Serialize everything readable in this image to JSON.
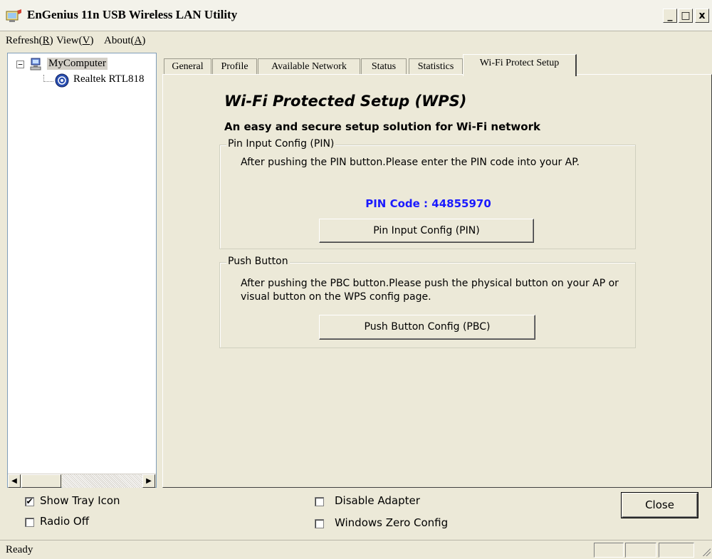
{
  "window": {
    "title": "EnGenius 11n USB Wireless LAN Utility",
    "controls": [
      "minimize-icon",
      "maximize-icon",
      "close-icon"
    ]
  },
  "menu": {
    "items": [
      {
        "label": "Refresh(",
        "key": "R",
        "suffix": ")"
      },
      {
        "label": "View(",
        "key": "V",
        "suffix": ")"
      },
      {
        "label": "About(",
        "key": "A",
        "suffix": ")"
      }
    ]
  },
  "tree": {
    "expander": "−",
    "root": "MyComputer",
    "child": "Realtek RTL818"
  },
  "tabs": [
    {
      "label": "General"
    },
    {
      "label": "Profile"
    },
    {
      "label": "Available Network"
    },
    {
      "label": "Status"
    },
    {
      "label": "Statistics"
    },
    {
      "label": "Wi-Fi Protect Setup",
      "active": true
    }
  ],
  "wps": {
    "title": "Wi-Fi Protected Setup (WPS)",
    "subtitle": "An easy and secure setup solution for Wi-Fi network",
    "pin": {
      "legend": "Pin Input Config (PIN)",
      "description": "After pushing the PIN button.Please enter the PIN code into your AP.",
      "code_label": "PIN Code :",
      "code_value": "44855970",
      "button": "Pin Input Config (PIN)"
    },
    "pbc": {
      "legend": "Push Button",
      "description": "After pushing the PBC button.Please push the physical button on your AP or visual button on the WPS config page.",
      "button": "Push Button Config (PBC)"
    }
  },
  "options": {
    "show_tray_icon": {
      "label": "Show Tray Icon",
      "checked": true
    },
    "radio_off": {
      "label": "Radio Off",
      "checked": false
    },
    "disable_adapter": {
      "label": "Disable Adapter",
      "checked": false
    },
    "windows_zero_config": {
      "label": "Windows Zero Config",
      "checked": false
    }
  },
  "close_button": "Close",
  "status": {
    "text": "Ready"
  },
  "colors": {
    "pin_code": "#1a1aff",
    "background": "#ece9d8"
  }
}
